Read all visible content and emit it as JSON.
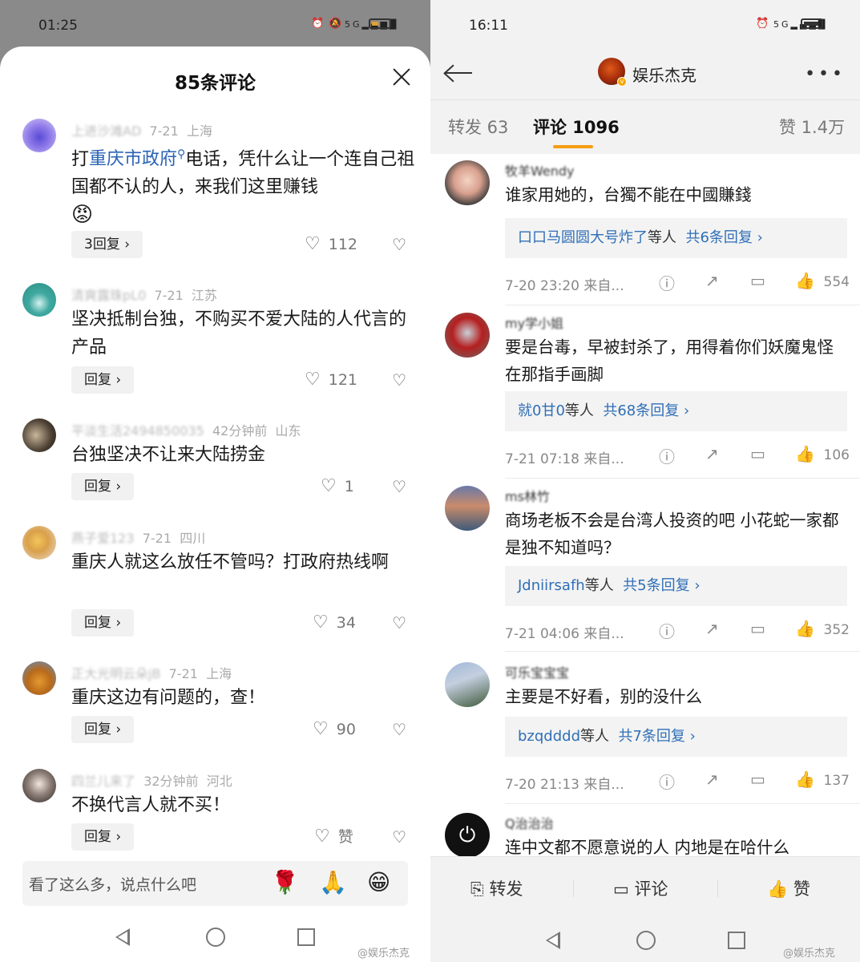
{
  "left": {
    "status": {
      "time": "01:25",
      "signal": "5G"
    },
    "sheet_title": "85条评论",
    "comments": [
      {
        "user": "上进沙滩AD",
        "date": "7-21",
        "location": "上海",
        "text_prefix": "打",
        "text_link": "重庆市政府",
        "text_suffix": "电话，凭什么让一个连自己祖国都不认的人，来我们这里赚钱",
        "emoji": "😡",
        "reply_label": "3回复 ›",
        "likes": "112"
      },
      {
        "user": "清爽露珠pL0",
        "date": "7-21",
        "location": "江苏",
        "text": "坚决抵制台独，不购买不爱大陆的人代言的产品",
        "reply_label": "回复 ›",
        "likes": "121"
      },
      {
        "user": "平淡生活2494850035",
        "date": "42分钟前",
        "location": "山东",
        "text": "台独坚决不让来大陆捞金",
        "reply_label": "回复 ›",
        "likes": "1"
      },
      {
        "user": "燕子爱123",
        "date": "7-21",
        "location": "四川",
        "text": "重庆人就这么放任不管吗？打政府热线啊",
        "reply_label": "回复 ›",
        "likes": "34"
      },
      {
        "user": "正大光明云朵jB",
        "date": "7-21",
        "location": "上海",
        "text": "重庆这边有问题的，查！",
        "reply_label": "回复 ›",
        "likes": "90"
      },
      {
        "user": "四兰儿来了",
        "date": "32分钟前",
        "location": "河北",
        "text": "不换代言人就不买！",
        "reply_label": "回复 ›",
        "likes": "赞"
      }
    ],
    "input_placeholder": "看了这么多，说点什么吧",
    "input_emojis": [
      "🌹",
      "🙏",
      "😁"
    ],
    "watermark": "@娱乐杰克"
  },
  "right": {
    "status": {
      "time": "16:11",
      "signal": "5G"
    },
    "profile_name": "娱乐杰克",
    "tabs": {
      "repost": "转发 63",
      "comments": "评论 1096",
      "likes": "赞 1.4万"
    },
    "comments": [
      {
        "user": "牧羊Wendy",
        "text": "谁家用她的，台獨不能在中國賺錢",
        "replies_user": "口口马圆圆大号炸了",
        "replies_suffix": "等人",
        "replies_count": "共6条回复 ›",
        "date": "7-20 23:20 来自...",
        "likes": "554"
      },
      {
        "user": "my学小姐",
        "text": "要是台毒，早被封杀了，用得着你们妖魔鬼怪在那指手画脚",
        "replies_user": "就0甘0",
        "replies_suffix": "等人",
        "replies_count": "共68条回复 ›",
        "date": "7-21 07:18 来自...",
        "likes": "106"
      },
      {
        "user": "ms林竹",
        "text": "商场老板不会是台湾人投资的吧 小花蛇一家都是独不知道吗？",
        "replies_user": "Jdniirsafh",
        "replies_suffix": "等人",
        "replies_count": "共5条回复 ›",
        "date": "7-21 04:06 来自...",
        "likes": "352"
      },
      {
        "user": "可乐宝宝宝",
        "text": "主要是不好看，别的没什么",
        "replies_user": "bzqdddd",
        "replies_suffix": "等人",
        "replies_count": "共7条回复 ›",
        "date": "7-20 21:13 来自...",
        "likes": "137"
      },
      {
        "user": "Q治治治",
        "text": "连中文都不愿意说的人  内地是在哈什么"
      }
    ],
    "bottom": {
      "repost": "转发",
      "comment": "评论",
      "like": "赞"
    },
    "watermark": "@娱乐杰克"
  },
  "colors": {
    "link": "#2a63b6",
    "accent": "#f59d13",
    "reply_link": "#2f6fb7"
  }
}
